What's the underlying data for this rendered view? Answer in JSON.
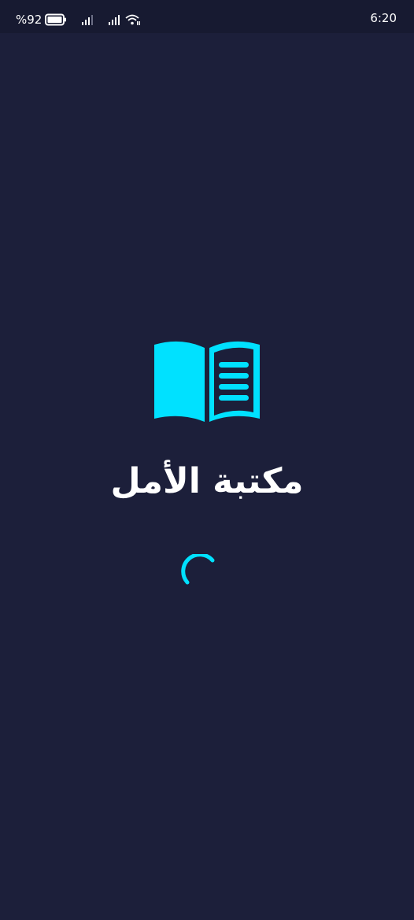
{
  "status_bar": {
    "battery_percent": "%92",
    "time": "6:20",
    "icons": [
      "battery-icon",
      "signal-icon",
      "signal-icon",
      "wifi-icon"
    ]
  },
  "splash": {
    "logo_icon": "open-book-icon",
    "app_name": "مكتبة الأمل",
    "loading_indicator": "spinner-icon"
  },
  "colors": {
    "background": "#1c1f3a",
    "status_bar": "#171a31",
    "accent": "#00e1ff",
    "text": "#ffffff"
  }
}
